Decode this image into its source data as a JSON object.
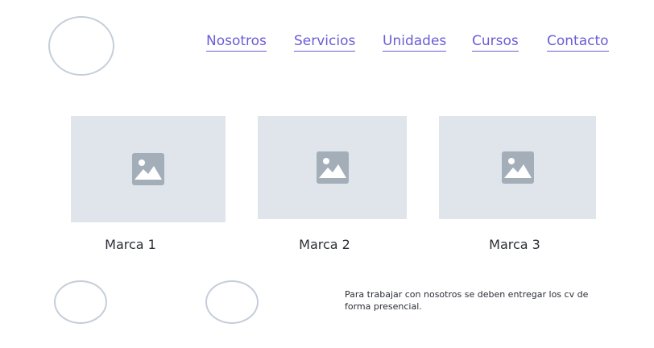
{
  "nav": {
    "items": [
      {
        "label": "Nosotros"
      },
      {
        "label": "Servicios"
      },
      {
        "label": "Unidades"
      },
      {
        "label": "Cursos"
      },
      {
        "label": "Contacto"
      }
    ]
  },
  "colors": {
    "link": "#6b5cd6",
    "placeholder_bg": "#e0e5ec",
    "placeholder_icon": "#a3aeb9",
    "circle_border": "#c5ced9"
  },
  "brands": [
    {
      "caption": "Marca 1",
      "icon": "image-placeholder-icon"
    },
    {
      "caption": "Marca 2",
      "icon": "image-placeholder-icon"
    },
    {
      "caption": "Marca 3",
      "icon": "image-placeholder-icon"
    }
  ],
  "footer": {
    "text": "Para trabajar con nosotros se deben entregar los cv de forma presencial."
  }
}
